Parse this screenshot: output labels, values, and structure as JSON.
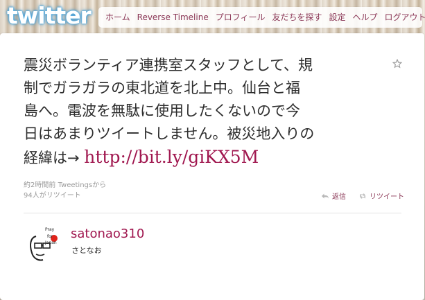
{
  "brand": {
    "logo_text": "twitter",
    "logo_glow": "#4aa1d9"
  },
  "nav": {
    "items": [
      {
        "label": "ホーム"
      },
      {
        "label": "Reverse Timeline"
      },
      {
        "label": "プロフィール"
      },
      {
        "label": "友だちを探す"
      },
      {
        "label": "設定"
      },
      {
        "label": "ヘルプ"
      },
      {
        "label": "ログアウト"
      }
    ]
  },
  "tweet": {
    "lines": [
      "震災ボランティア連携室スタッフとして、規",
      "制でガラガラの東北道を北上中。仙台と福",
      "島へ。電波を無駄に使用したくないので今",
      "日はあまりツイートしません。被災地入りの"
    ],
    "last_line_prefix": "経緯は→ ",
    "url": "http://bit.ly/giKX5M",
    "time_ago": "約2時間前",
    "via_label": "Tweetingsから",
    "retweet_count": "94人がリツイート",
    "favorite_icon": "star-icon"
  },
  "actions": {
    "reply_label": "返信",
    "reply_icon": "reply-arrow-icon",
    "retweet_label": "リツイート",
    "retweet_icon": "retweet-icon"
  },
  "author": {
    "username": "satonao310",
    "display_name": "さとなお",
    "avatar_text_lines": [
      "Pray",
      "for",
      "Japan"
    ]
  },
  "colors": {
    "link": "#a0174f",
    "nav_link": "#8a3655",
    "text": "#2d2d2d",
    "meta": "#9a9a9a",
    "flag_red": "#e0231b"
  }
}
